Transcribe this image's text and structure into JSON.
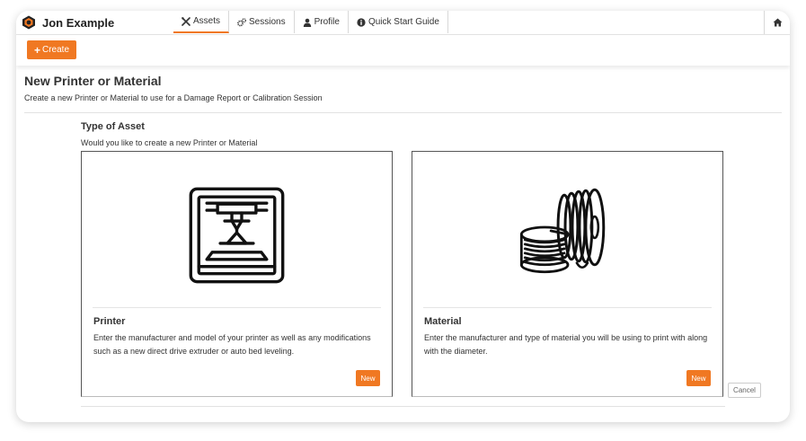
{
  "header": {
    "username": "Jon Example",
    "nav": [
      {
        "label": "Assets",
        "icon": "tools-icon",
        "active": true
      },
      {
        "label": "Sessions",
        "icon": "gears-icon",
        "active": false
      },
      {
        "label": "Profile",
        "icon": "user-icon",
        "active": false
      },
      {
        "label": "Quick Start Guide",
        "icon": "info-circle-icon",
        "active": false
      }
    ],
    "home_icon": "home-icon"
  },
  "toolbar": {
    "create_label": "Create",
    "create_icon": "plus-icon"
  },
  "page": {
    "title": "New Printer or Material",
    "subtitle": "Create a new Printer or Material to use for a Damage Report or Calibration Session"
  },
  "asset_type": {
    "title": "Type of Asset",
    "subtitle": "Would you like to create a new Printer or Material",
    "cards": [
      {
        "title": "Printer",
        "description": "Enter the manufacturer and model of your printer as well as any modifications such as a new direct drive extruder or auto bed leveling.",
        "button_label": "New",
        "icon": "3d-printer-icon"
      },
      {
        "title": "Material",
        "description": "Enter the manufacturer and type of material you will be using to print with along with the diameter.",
        "button_label": "New",
        "icon": "filament-spool-icon"
      }
    ]
  },
  "cancel_label": "Cancel",
  "colors": {
    "accent": "#f07822",
    "text": "#333333"
  }
}
